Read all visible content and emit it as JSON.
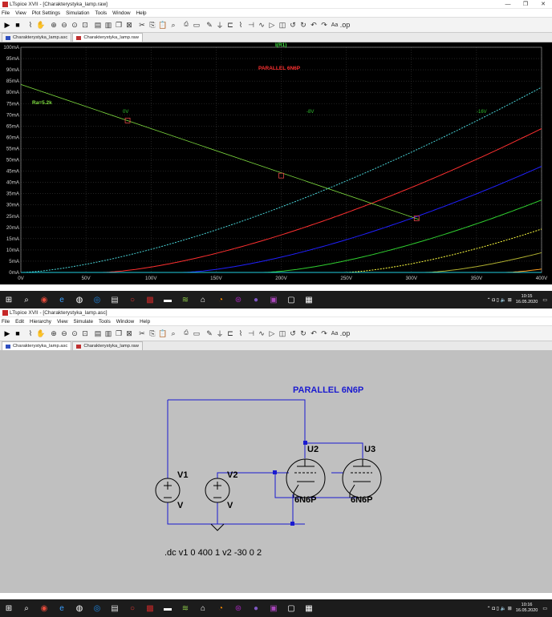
{
  "top": {
    "title": "LTspice XVII - [Charakterystyka_lamp.raw]",
    "menu": [
      "File",
      "View",
      "Plot Settings",
      "Simulation",
      "Tools",
      "Window",
      "Help"
    ],
    "tabs": [
      "Charakterystyka_lamp.asc",
      "Charakterystyka_lamp.raw"
    ]
  },
  "bottom": {
    "title": "LTspice XVII - [Charakterystyka_lamp.asc]",
    "menu": [
      "File",
      "Edit",
      "Hierarchy",
      "View",
      "Simulate",
      "Tools",
      "Window",
      "Help"
    ],
    "tabs": [
      "Charakterystyka_lamp.asc",
      "Charakterystyka_lamp.raw"
    ]
  },
  "window_controls": [
    "—",
    "❐",
    "✕"
  ],
  "toolbar_icons": [
    "run-icon",
    "halt-icon",
    "wire-icon",
    "hand-icon",
    "zoom-in-icon",
    "zoom-out-icon",
    "zoom-back-icon",
    "zoom-fit-icon",
    "tile-h-icon",
    "tile-v-icon",
    "cascade-icon",
    "close-all-icon",
    "cut-icon",
    "copy-icon",
    "paste-icon",
    "find-icon",
    "print-icon",
    "print-preview-icon",
    "draw-wire-icon",
    "ground-icon",
    "label-icon",
    "resistor-icon",
    "capacitor-icon",
    "inductor-icon",
    "diode-icon",
    "component-icon",
    "rotate-icon",
    "mirror-icon",
    "undo-icon",
    "redo-icon",
    "text-icon",
    "spice-directive-icon"
  ],
  "taskbar": {
    "icons": [
      "windows-start-icon",
      "search-icon",
      "chrome-icon",
      "edge-icon",
      "app-icon",
      "steam-icon",
      "app-icon",
      "opera-icon",
      "ltspice-icon",
      "folder-icon",
      "app-icon",
      "app-icon",
      "app-icon",
      "app-icon",
      "app-icon",
      "app-icon",
      "app-icon",
      "app-icon"
    ],
    "top_time": "10:15",
    "top_date": "16.05.2020",
    "bottom_time": "10:16",
    "bottom_date": "16.05.2020"
  },
  "plot": {
    "trace_label": "I(R1)",
    "title_text": "PARALLEL 6N6P",
    "loadline_label": "Ra=5.2k",
    "grid_labels": [
      "0V",
      "-8V",
      "-16V"
    ],
    "y_ticks": [
      "100mA",
      "95mA",
      "90mA",
      "85mA",
      "80mA",
      "75mA",
      "70mA",
      "65mA",
      "60mA",
      "55mA",
      "50mA",
      "45mA",
      "40mA",
      "35mA",
      "30mA",
      "25mA",
      "20mA",
      "15mA",
      "10mA",
      "5mA",
      "0mA"
    ],
    "x_ticks": [
      "0V",
      "50V",
      "100V",
      "150V",
      "200V",
      "250V",
      "300V",
      "350V",
      "400V"
    ]
  },
  "chart_data": {
    "type": "line",
    "title": "PARALLEL 6N6P",
    "xlabel": "",
    "ylabel": "I(R1)",
    "xlim": [
      0,
      400
    ],
    "ylim": [
      0,
      100
    ],
    "grid": true,
    "x_unit": "V",
    "y_unit": "mA",
    "curves": [
      {
        "vg": 0,
        "color": "#4ad4d8",
        "dashed": true
      },
      {
        "vg": -2,
        "color": "#ff3030"
      },
      {
        "vg": -4,
        "color": "#2020ff"
      },
      {
        "vg": -6,
        "color": "#30d030"
      },
      {
        "vg": -8,
        "color": "#ffff40",
        "dashed": true
      },
      {
        "vg": -10,
        "color": "#b0b030"
      },
      {
        "vg": -12,
        "color": "#ffa020"
      },
      {
        "vg": -14,
        "color": "#c00010"
      },
      {
        "vg": -16,
        "color": "#d040d0"
      },
      {
        "vg": -18,
        "color": "#20c020"
      },
      {
        "vg": -20,
        "color": "#3030ff"
      },
      {
        "vg": -22,
        "color": "#ff40ff"
      },
      {
        "vg": -24,
        "color": "#20a020"
      },
      {
        "vg": -26,
        "color": "#c8c8c8"
      },
      {
        "vg": -28,
        "color": "#ff30ff"
      },
      {
        "vg": -30,
        "color": "#20d0e0"
      }
    ],
    "load_line": {
      "x": [
        0,
        306
      ],
      "y": [
        83.5,
        23.5
      ],
      "color": "#80e040"
    },
    "markers": [
      {
        "x": 82,
        "y": 67.5
      },
      {
        "x": 200,
        "y": 43
      },
      {
        "x": 304,
        "y": 24
      }
    ]
  },
  "schematic": {
    "title_text": "PARALLEL 6N6P",
    "directive": ".dc v1 0 400 1 v2 -30 0 2",
    "v1": {
      "name": "V1",
      "value": "V"
    },
    "v2": {
      "name": "V2",
      "value": "V"
    },
    "u2": {
      "name": "U2",
      "value": "6N6P"
    },
    "u3": {
      "name": "U3",
      "value": "6N6P"
    }
  }
}
